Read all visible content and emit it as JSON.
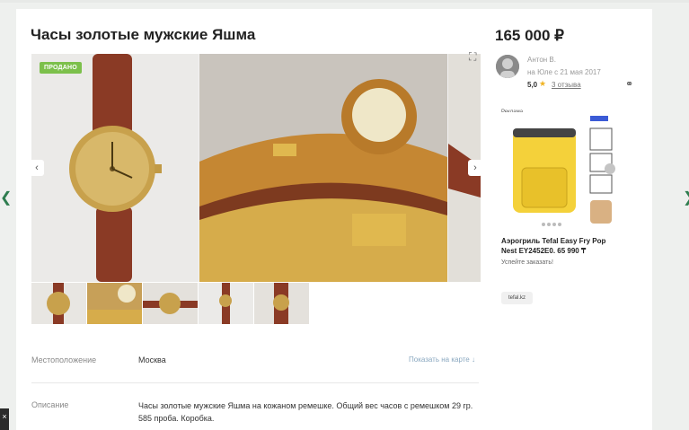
{
  "listing": {
    "title": "Часы золотые мужские Яшма",
    "price": "165 000 ₽",
    "sold_badge": "ПРОДАНО",
    "gallery": {
      "prev_icon": "chevron-left-icon",
      "next_icon": "chevron-right-icon",
      "expand_icon": "expand-icon",
      "thumbnail_count": 5
    }
  },
  "seller": {
    "name": "Антон В.",
    "since": "на Юле с 21 мая 2017",
    "rating": "5,0",
    "reviews": "3 отзыва"
  },
  "ad": {
    "label": "Реклама",
    "title": "Аэрогриль Tefal Easy Fry Pop Nest EY2452E0. 65 990 ₸",
    "cta": "Успейте заказать!",
    "source": "tefal.kz"
  },
  "details": {
    "location_label": "Местоположение",
    "location_value": "Москва",
    "map_link": "Показать на карте ↓",
    "description_label": "Описание",
    "description_value": "Часы золотые мужские Яшма на кожаном ремешке. Общий вес часов с ремешком 29 гр. 585 проба. Коробка."
  },
  "colors": {
    "sold_badge": "#7cc04b",
    "brand_green": "#2e7d4f",
    "star": "#f0b323",
    "link": "#8aa8c0"
  }
}
